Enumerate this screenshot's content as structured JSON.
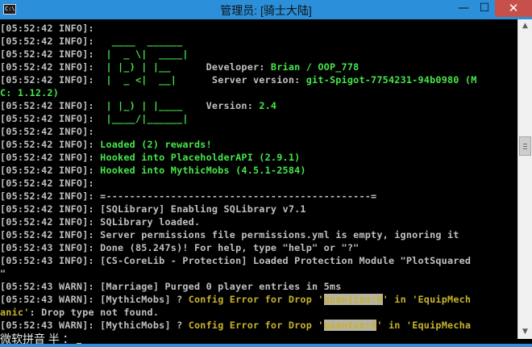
{
  "window": {
    "title": "管理员: [骑士大陆]",
    "icon_text": "C:\\",
    "minimize_glyph": "—",
    "maximize_glyph": "☐",
    "close_glyph": "✕"
  },
  "colors": {
    "title_bar": "#2b8fd9",
    "close_button": "#c7504b",
    "console_bg": "#000000",
    "text_gray": "#c0c0c0",
    "text_green": "#46e64a",
    "text_yellow": "#c7b22f",
    "highlight": "#b6b3a2"
  },
  "console": {
    "lines": [
      [
        {
          "t": "[05:52:42 INFO]:"
        }
      ],
      [
        {
          "t": "[05:52:42 INFO]: "
        },
        {
          "t": "  ____  ______",
          "c": "green"
        }
      ],
      [
        {
          "t": "[05:52:42 INFO]: "
        },
        {
          "t": " |  _ \\|  ____|",
          "c": "green"
        }
      ],
      [
        {
          "t": "[05:52:42 INFO]: "
        },
        {
          "t": " | |_) | |__",
          "c": "green"
        },
        {
          "t": "      Developer: "
        },
        {
          "t": "Brian / OOP_778",
          "c": "green"
        }
      ],
      [
        {
          "t": "[05:52:42 INFO]: "
        },
        {
          "t": " |  _ <|  __|",
          "c": "green"
        },
        {
          "t": "      Server version: "
        },
        {
          "t": "git-Spigot-7754231-94b0980 (M",
          "c": "green"
        }
      ],
      [
        {
          "t": "C: 1.12.2)",
          "c": "green"
        }
      ],
      [
        {
          "t": "[05:52:42 INFO]: "
        },
        {
          "t": " | |_) | |____",
          "c": "green"
        },
        {
          "t": "    Version: "
        },
        {
          "t": "2.4",
          "c": "green"
        }
      ],
      [
        {
          "t": "[05:52:42 INFO]: "
        },
        {
          "t": " |____/|______|",
          "c": "green"
        }
      ],
      [
        {
          "t": "[05:52:42 INFO]:"
        }
      ],
      [
        {
          "t": "[05:52:42 INFO]: "
        },
        {
          "t": "Loaded (2) rewards!",
          "c": "green"
        }
      ],
      [
        {
          "t": "[05:52:42 INFO]: "
        },
        {
          "t": "Hooked into PlaceholderAPI (2.9.1)",
          "c": "green"
        }
      ],
      [
        {
          "t": "[05:52:42 INFO]: "
        },
        {
          "t": "Hooked into MythicMobs (4.5.1-2584)",
          "c": "green"
        }
      ],
      [
        {
          "t": "[05:52:42 INFO]:"
        }
      ],
      [
        {
          "t": "[05:52:42 INFO]: =---------------------------------------------="
        }
      ],
      [
        {
          "t": "[05:52:42 INFO]: [SQLibrary] Enabling SQLibrary v7.1"
        }
      ],
      [
        {
          "t": "[05:52:42 INFO]: SQLibrary loaded."
        }
      ],
      [
        {
          "t": "[05:52:42 INFO]: Server permissions file permissions.yml is empty, ignoring it"
        }
      ],
      [
        {
          "t": "[05:52:43 INFO]: Done (85.247s)! For help, type \"help\" or \"?\""
        }
      ],
      [
        {
          "t": "[05:52:43 INFO]: [CS-CoreLib - Protection] Loaded Protection Module \"PlotSquared"
        }
      ],
      [
        {
          "t": "\""
        }
      ],
      [
        {
          "t": "[05:52:43 WARN]: [Marriage] Purged 0 player entries in 5ms"
        }
      ],
      [
        {
          "t": "[05:52:43 WARN]: [MythicMobs] ? "
        },
        {
          "t": "Config Error for Drop '",
          "c": "yellow"
        },
        {
          "t": "quanjian:0",
          "c": "hl"
        },
        {
          "t": "' in 'EquipMech",
          "c": "yellow"
        }
      ],
      [
        {
          "t": "anic'",
          "c": "yellow"
        },
        {
          "t": ": Drop type not found."
        }
      ],
      [
        {
          "t": "[05:52:43 WARN]: [MythicMobs] ? "
        },
        {
          "t": "Config Error for Drop '",
          "c": "yellow"
        },
        {
          "t": "quanton:0",
          "c": "hl"
        },
        {
          "t": "' in 'EquipMecha",
          "c": "yellow"
        }
      ]
    ]
  },
  "ime": {
    "status": "微软拼音 半 ："
  },
  "scrollbar": {
    "up_arrow": "▲",
    "down_arrow": "▼"
  }
}
